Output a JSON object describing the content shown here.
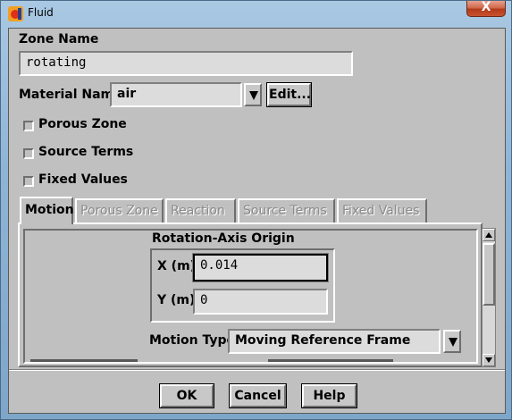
{
  "window": {
    "title": "Fluid",
    "close_label": "X"
  },
  "zone": {
    "label": "Zone Name",
    "value": "rotating"
  },
  "material": {
    "label": "Material Name",
    "value": "air",
    "edit_label": "Edit..."
  },
  "options": [
    {
      "label": "Porous Zone",
      "checked": false
    },
    {
      "label": "Source Terms",
      "checked": false
    },
    {
      "label": "Fixed Values",
      "checked": false
    }
  ],
  "tabs": [
    {
      "label": "Motion",
      "active": true,
      "enabled": true
    },
    {
      "label": "Porous Zone",
      "active": false,
      "enabled": false
    },
    {
      "label": "Reaction",
      "active": false,
      "enabled": false
    },
    {
      "label": "Source Terms",
      "active": false,
      "enabled": false
    },
    {
      "label": "Fixed Values",
      "active": false,
      "enabled": false
    }
  ],
  "motion": {
    "origin_title": "Rotation-Axis Origin",
    "x_label": "X (m)",
    "x_value": "0.014",
    "y_label": "Y (m)",
    "y_value": "0",
    "motion_type_label": "Motion Type",
    "motion_type_value": "Moving Reference Frame"
  },
  "buttons": {
    "ok": "OK",
    "cancel": "Cancel",
    "help": "Help"
  },
  "colors": {
    "dialog_bg": "#c0c0c0",
    "field_bg": "#dcdcdc",
    "disabled_text": "#8a8a8a",
    "close_red": "#c9532f"
  }
}
